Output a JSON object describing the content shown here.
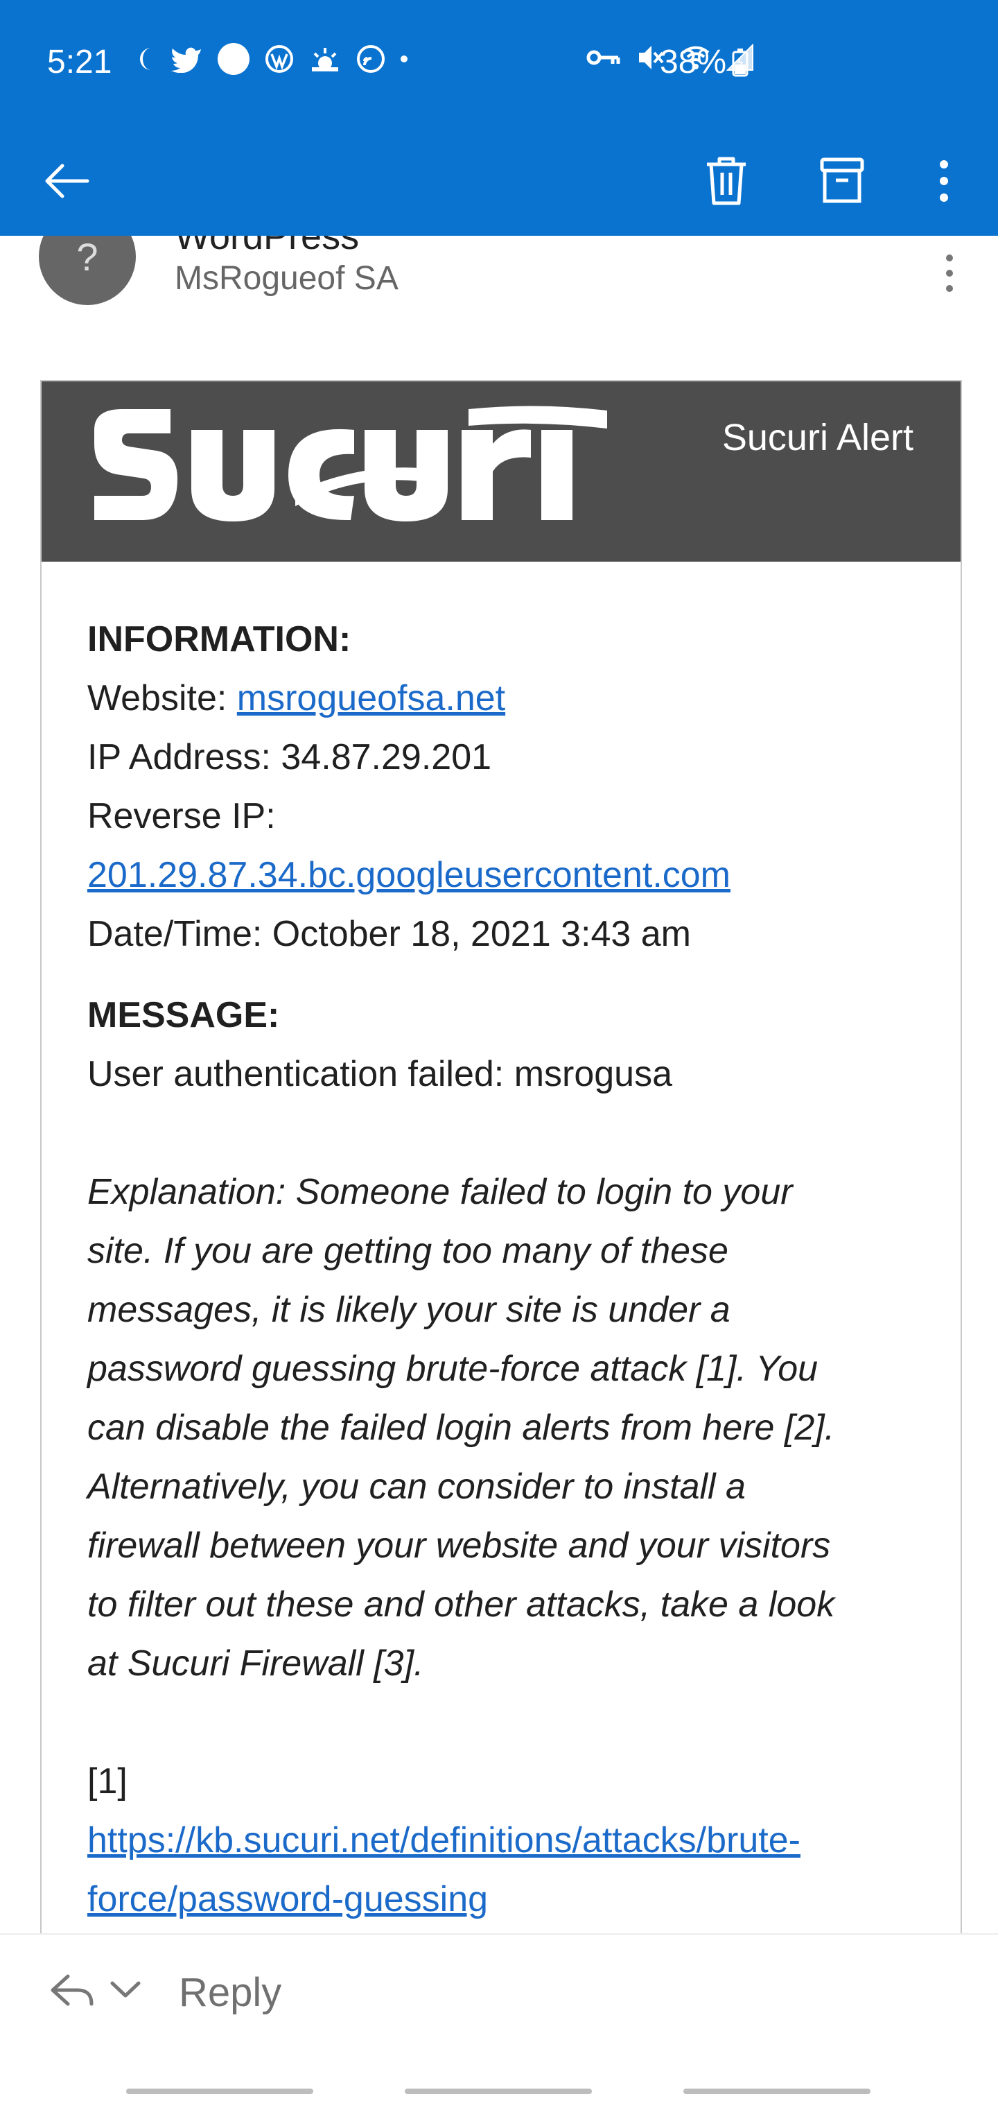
{
  "status_bar": {
    "time": "5:21",
    "battery": "38%",
    "icons_left": [
      "moon-icon",
      "twitter-icon",
      "circle-icon",
      "wordpress-icon",
      "weather-icon",
      "cast-icon",
      "dot-icon"
    ],
    "icons_right": [
      "key-icon",
      "mute-icon",
      "wifi-icon",
      "signal-icon"
    ]
  },
  "toolbar": {
    "back_label": "Back",
    "delete_label": "Delete",
    "archive_label": "Archive",
    "more_label": "More options"
  },
  "sender": {
    "avatar_initial": "?",
    "name_partial": "WordPress",
    "recipient": "MsRogueof SA"
  },
  "email": {
    "brand_alert": "Sucuri Alert",
    "information_heading": "INFORMATION:",
    "website_label": "Website: ",
    "website_link": "msrogueofsa.net",
    "ip_address_line": "IP Address: 34.87.29.201",
    "reverse_ip_label": "Reverse IP:",
    "reverse_ip_link": "201.29.87.34.bc.googleusercontent.com",
    "datetime_line": "Date/Time: October 18, 2021 3:43 am",
    "message_heading": "MESSAGE:",
    "message_line": "User authentication failed: msrogusa",
    "explanation_lines": [
      "Explanation: Someone failed to login to your",
      "site. If you are getting too many of these",
      "messages, it is likely your site is under a",
      "password guessing brute-force attack [1]. You",
      "can disable the failed login alerts from here [2].",
      "Alternatively, you can consider to install a",
      "firewall between your website and your visitors",
      "to filter out these and other attacks, take a look",
      "at Sucuri Firewall [3]."
    ],
    "ref1_label": "[1]",
    "ref1_link_lines": [
      "https://kb.sucuri.net/definitions/attacks/brute-",
      "force/password-guessing"
    ]
  },
  "reply_bar": {
    "reply_label": "Reply"
  },
  "colors": {
    "primary": "#0a73d0",
    "brand_header": "#4d4d4d",
    "link": "#1b6ac9"
  }
}
